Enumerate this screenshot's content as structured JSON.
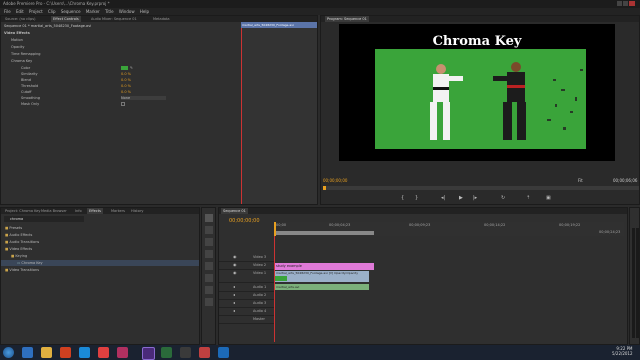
{
  "app": {
    "title": "Adobe Premiere Pro - C:\\Users\\...\\Chroma Key.prproj *"
  },
  "menu": [
    "File",
    "Edit",
    "Project",
    "Clip",
    "Sequence",
    "Marker",
    "Title",
    "Window",
    "Help"
  ],
  "source_tabs": [
    "Source: (no clips)",
    "Effect Controls",
    "Audio Mixer: Sequence 01",
    "Metadata"
  ],
  "effect_controls": {
    "header": "Sequence 01 * martial_arts_5048230_Footage.avi",
    "section": "Video Effects",
    "motion": "Motion",
    "opacity": "Opacity",
    "time_remap": "Time Remapping",
    "chroma_key": "Chroma Key",
    "params": [
      {
        "name": "Color",
        "value": ""
      },
      {
        "name": "Similarity",
        "value": "0.0 %"
      },
      {
        "name": "Blend",
        "value": "0.0 %"
      },
      {
        "name": "Threshold",
        "value": "0.0 %"
      },
      {
        "name": "Cutoff",
        "value": "0.0 %"
      },
      {
        "name": "Smoothing",
        "value": "None"
      },
      {
        "name": "Mask Only",
        "value": ""
      }
    ],
    "clip_label": "martial_arts_5048230_Footage.avi"
  },
  "program": {
    "tab": "Program: Sequence 01",
    "title_text": "Chroma Key",
    "timecode_left": "00;00;00;00",
    "timecode_right": "00;00;06;06",
    "fit": "Fit"
  },
  "project_tabs": [
    "Project: Chroma Key",
    "Media Browser",
    "Info",
    "Effects",
    "Markers",
    "History"
  ],
  "effects_tree": [
    {
      "label": "Presets",
      "level": 0
    },
    {
      "label": "Audio Effects",
      "level": 0
    },
    {
      "label": "Audio Transitions",
      "level": 0
    },
    {
      "label": "Video Effects",
      "level": 0
    },
    {
      "label": "Keying",
      "level": 1
    },
    {
      "label": "Chroma Key",
      "level": 2
    },
    {
      "label": "Video Transitions",
      "level": 0
    }
  ],
  "effects_search": "chroma",
  "timeline": {
    "tab": "Sequence 01",
    "timecode": "00;00;00;00",
    "ruler": [
      "00;00",
      "00;00;04;23",
      "00;00;09;23",
      "00;00;14;22",
      "00;00;19;22",
      "00;00;24;23"
    ],
    "tracks": [
      "Video 3",
      "Video 2",
      "Video 1",
      "Audio 1",
      "Audio 2",
      "Audio 3",
      "Audio 4",
      "Master"
    ],
    "clip_title": "study example",
    "clip_video": "martial_arts_5048230_Footage.avi [V] Opacity:Opacity",
    "clip_audio": "martial_arts.avi"
  },
  "taskbar": {
    "time": "9:22 PM",
    "date": "5/22/2012"
  },
  "colors": {
    "accent": "#e8a020",
    "greenscreen": "#3aa43a",
    "pink_clip": "#e07ad8"
  }
}
